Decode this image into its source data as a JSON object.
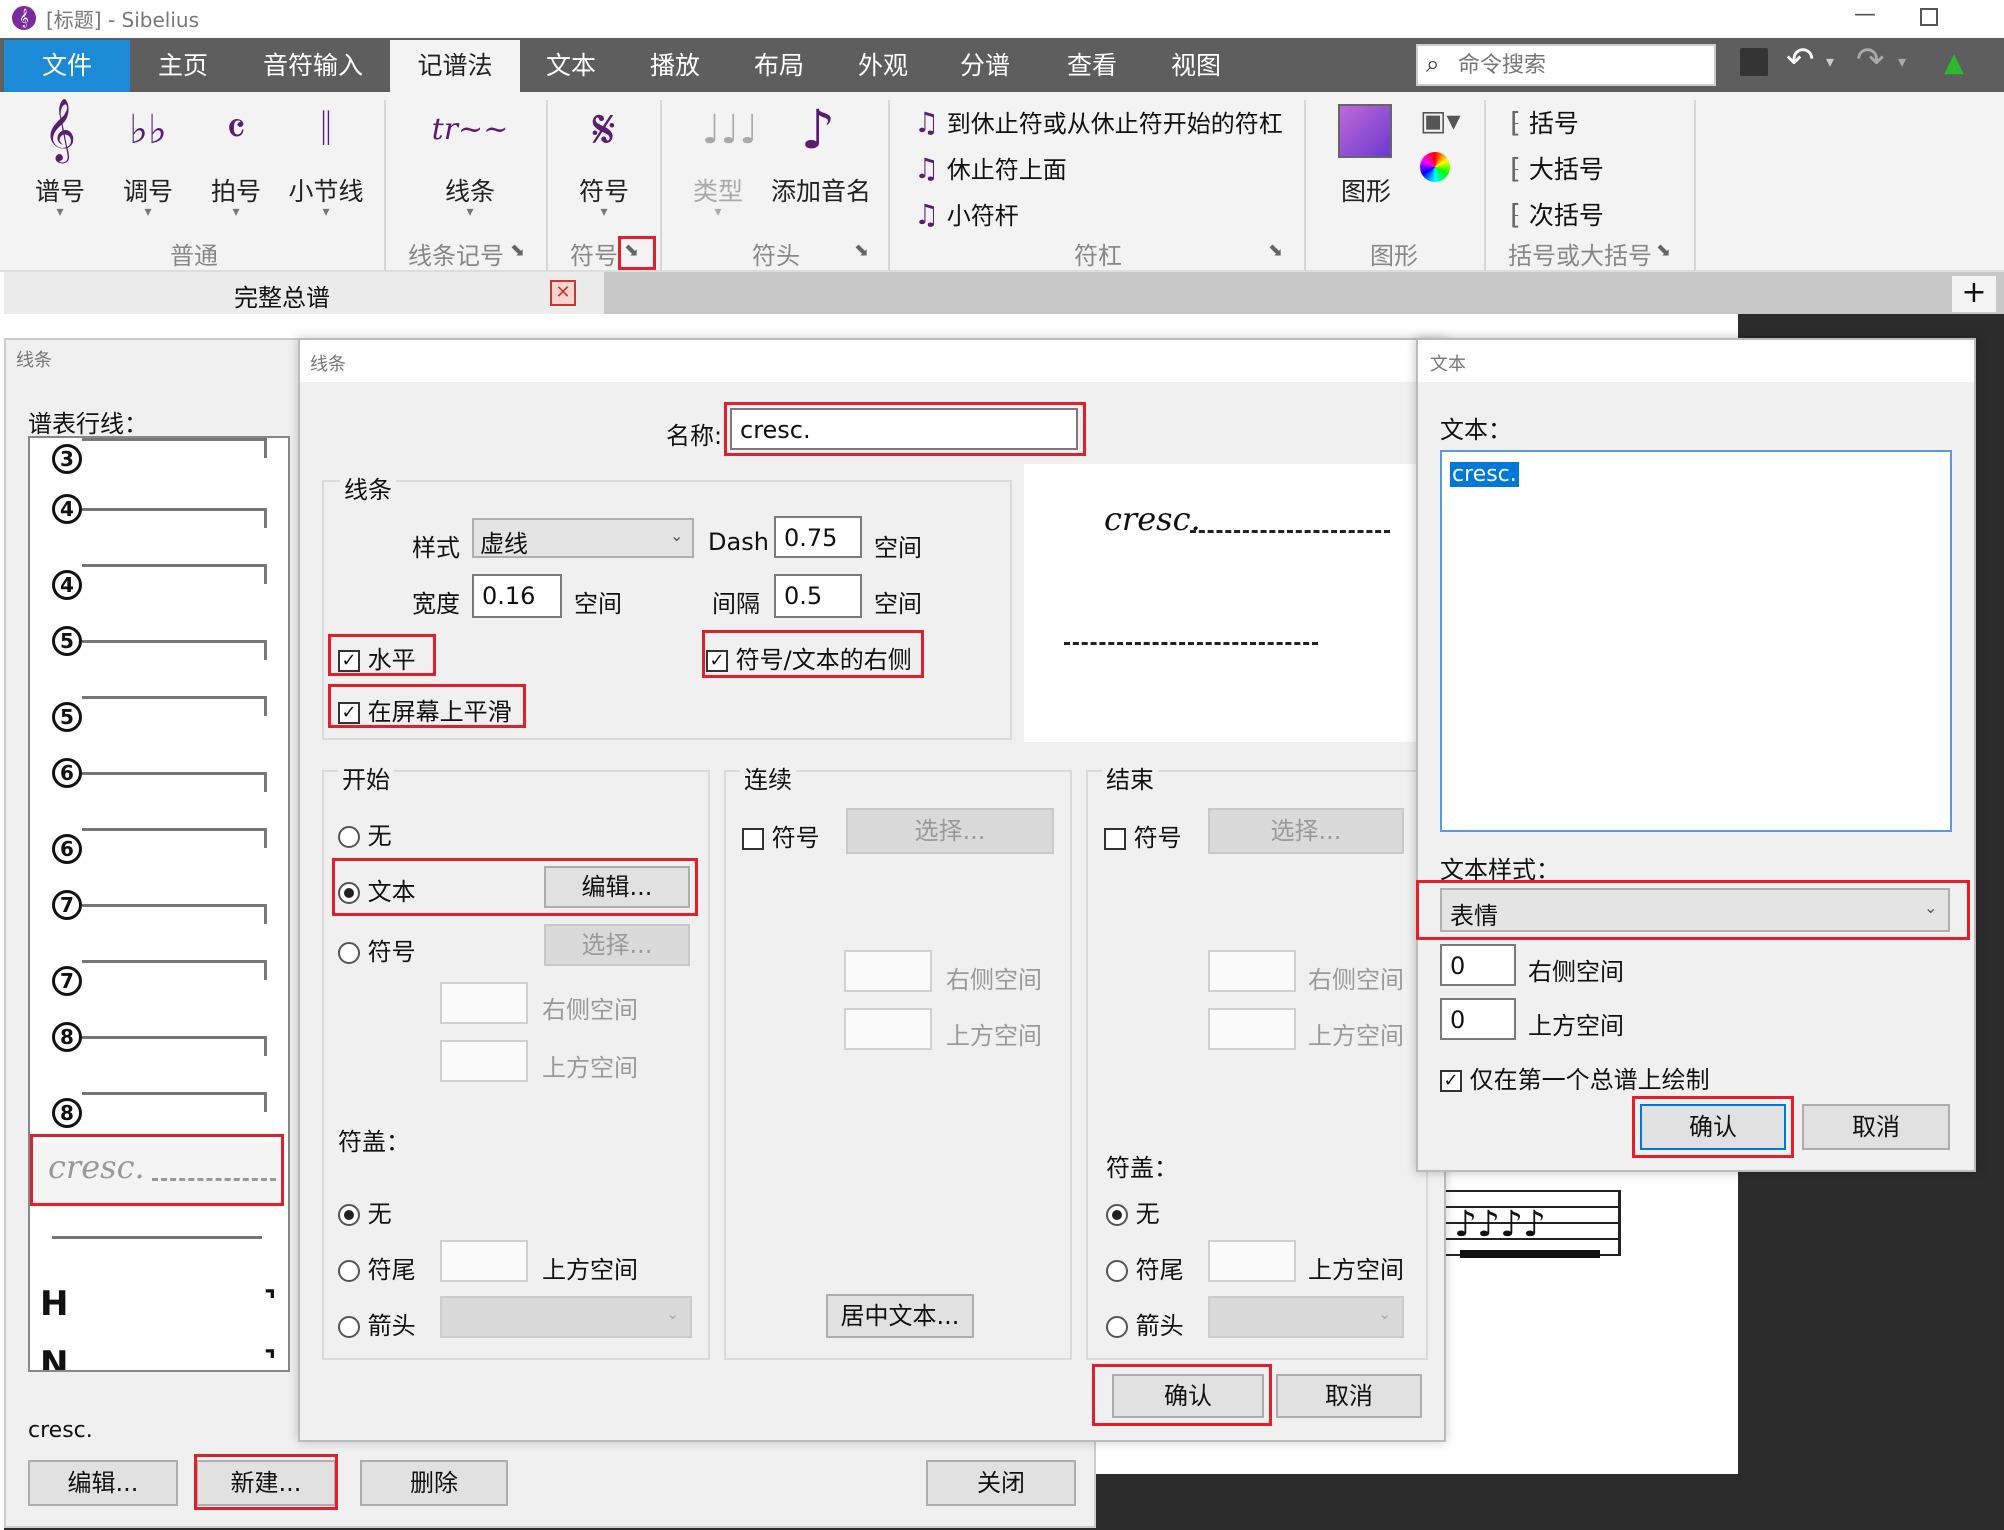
{
  "window": {
    "title": "[标题] - Sibelius"
  },
  "tabs": [
    "文件",
    "主页",
    "音符输入",
    "记谱法",
    "文本",
    "播放",
    "布局",
    "外观",
    "分谱",
    "查看",
    "视图"
  ],
  "search": {
    "placeholder": "命令搜索"
  },
  "ribbon": {
    "groups": {
      "normal": "普通",
      "lines": "线条记号",
      "symbols": "符号",
      "noteheads": "符头",
      "beams": "符杠",
      "graphics": "图形",
      "brackets": "括号或大括号"
    },
    "buttons": {
      "clef": "谱号",
      "key": "调号",
      "time": "拍号",
      "barline": "小节线",
      "line": "线条",
      "symbol": "符号",
      "type": "类型",
      "add_name": "添加音名",
      "graphic": "图形"
    },
    "beam_items": [
      "到休止符或从休止符开始的符杠",
      "休止符上面",
      "小符杆"
    ],
    "bracket_items": [
      "括号",
      "大括号",
      "次括号"
    ]
  },
  "doc_tab": {
    "label": "完整总谱"
  },
  "lines_panel": {
    "title": "线条",
    "section_label": "谱表行线：",
    "items": [
      "3",
      "4",
      "4",
      "5",
      "5",
      "6",
      "6",
      "7",
      "7",
      "8",
      "8"
    ],
    "selected_item": "cresc.",
    "selected_name": "cresc.",
    "bottom_items": [
      "H",
      "N"
    ],
    "buttons": {
      "edit": "编辑...",
      "new": "新建...",
      "delete": "删除",
      "close": "关闭"
    }
  },
  "line_dialog": {
    "title": "线条",
    "name_label": "名称:",
    "name_value": "cresc.",
    "group_line": "线条",
    "style_label": "样式",
    "style_value": "虚线",
    "dash_label": "Dash",
    "dash_value": "0.75",
    "space_unit": "空间",
    "width_label": "宽度",
    "width_value": "0.16",
    "gap_label": "间隔",
    "gap_value": "0.5",
    "horizontal_label": "水平",
    "smooth_label": "在屏幕上平滑",
    "right_of_label": "符号/文本的右侧",
    "preview_text": "cresc.",
    "start": {
      "title": "开始",
      "none": "无",
      "text": "文本",
      "symbol": "符号",
      "edit_btn": "编辑...",
      "choose_btn": "选择...",
      "right_space": "右侧空间",
      "above_space": "上方空间"
    },
    "continue": {
      "title": "连续",
      "symbol": "符号",
      "choose_btn": "选择...",
      "right_space": "右侧空间",
      "above_space": "上方空间",
      "center_btn": "居中文本..."
    },
    "end": {
      "title": "结束",
      "symbol": "符号",
      "choose_btn": "选择...",
      "right_space": "右侧空间",
      "above_space": "上方空间"
    },
    "hook_label": "符盖：",
    "hook_none": "无",
    "hook_tail": "符尾",
    "hook_arrow": "箭头",
    "hook_above": "上方空间",
    "ok": "确认",
    "cancel": "取消"
  },
  "text_dialog": {
    "title": "文本",
    "text_label": "文本：",
    "text_value": "cresc.",
    "style_label": "文本样式：",
    "style_value": "表情",
    "right_space_value": "0",
    "right_space_label": "右侧空间",
    "above_space_value": "0",
    "above_space_label": "上方空间",
    "first_system_label": "仅在第一个总谱上绘制",
    "ok": "确认",
    "cancel": "取消"
  }
}
